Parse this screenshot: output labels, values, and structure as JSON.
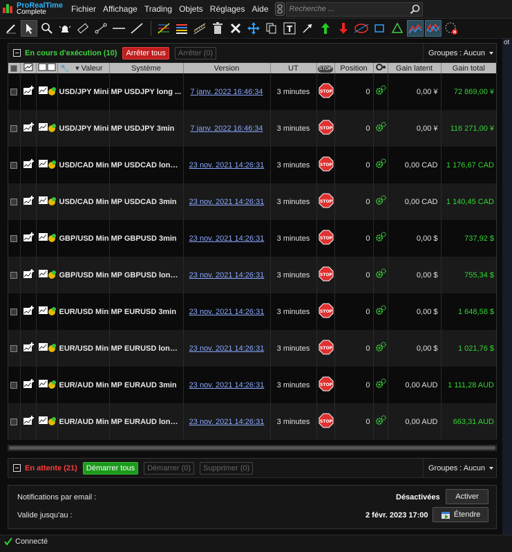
{
  "app": {
    "brand_line1": "ProRealTime",
    "brand_line2": "Complete"
  },
  "menu": [
    "Fichier",
    "Affichage",
    "Trading",
    "Objets",
    "Réglages",
    "Aide"
  ],
  "search": {
    "placeholder": "Recherche ..."
  },
  "running": {
    "title": "En cours d'exécution (10)",
    "stop_all_label": "Arrêter tous",
    "stop_label": "Arrêter (0)",
    "groups_label": "Groupes : Aucun",
    "columns": {
      "valeur": "Valeur",
      "systeme": "Système",
      "version": "Version",
      "ut": "UT",
      "stop": "STOP",
      "position": "Position",
      "gain_latent": "Gain latent",
      "gain_total": "Gain total"
    },
    "rows": [
      {
        "valeur": "USD/JPY Mini",
        "systeme": "MP USDJPY long ...",
        "version": "7 janv. 2022 16:46:34",
        "ut": "3 minutes",
        "position": "0",
        "gain_latent": "0,00 ¥",
        "gain_total": "72 869,00 ¥"
      },
      {
        "valeur": "USD/JPY Mini",
        "systeme": "MP USDJPY 3min",
        "version": "7 janv. 2022 16:46:34",
        "ut": "3 minutes",
        "position": "0",
        "gain_latent": "0,00 ¥",
        "gain_total": "116 271,00 ¥"
      },
      {
        "valeur": "USD/CAD Mini",
        "systeme": "MP USDCAD long ...",
        "version": "23 nov. 2021 14:26:31",
        "ut": "3 minutes",
        "position": "0",
        "gain_latent": "0,00 CAD",
        "gain_total": "1 176,67 CAD"
      },
      {
        "valeur": "USD/CAD Mini",
        "systeme": "MP USDCAD 3min",
        "version": "23 nov. 2021 14:26:31",
        "ut": "3 minutes",
        "position": "0",
        "gain_latent": "0,00 CAD",
        "gain_total": "1 140,45 CAD"
      },
      {
        "valeur": "GBP/USD Mini",
        "systeme": "MP GBPUSD 3min",
        "version": "23 nov. 2021 14:26:31",
        "ut": "3 minutes",
        "position": "0",
        "gain_latent": "0,00 $",
        "gain_total": "737,92 $"
      },
      {
        "valeur": "GBP/USD Mini",
        "systeme": "MP GBPUSD long ...",
        "version": "23 nov. 2021 14:26:31",
        "ut": "3 minutes",
        "position": "0",
        "gain_latent": "0,00 $",
        "gain_total": "755,34 $"
      },
      {
        "valeur": "EUR/USD Mini",
        "systeme": "MP EURUSD 3min",
        "version": "23 nov. 2021 14:26:31",
        "ut": "3 minutes",
        "position": "0",
        "gain_latent": "0,00 $",
        "gain_total": "1 648,58 $"
      },
      {
        "valeur": "EUR/USD Mini",
        "systeme": "MP EURUSD long ...",
        "version": "23 nov. 2021 14:26:31",
        "ut": "3 minutes",
        "position": "0",
        "gain_latent": "0,00 $",
        "gain_total": "1 021,76 $"
      },
      {
        "valeur": "EUR/AUD Mini",
        "systeme": "MP EURAUD 3min",
        "version": "23 nov. 2021 14:26:31",
        "ut": "3 minutes",
        "position": "0",
        "gain_latent": "0,00 AUD",
        "gain_total": "1 111,28 AUD"
      },
      {
        "valeur": "EUR/AUD Mini",
        "systeme": "MP EURAUD long ...",
        "version": "23 nov. 2021 14:26:31",
        "ut": "3 minutes",
        "position": "0",
        "gain_latent": "0,00 AUD",
        "gain_total": "663,31 AUD"
      }
    ]
  },
  "pending": {
    "title": "En attente (21)",
    "start_all_label": "Démarrer tous",
    "start_label": "Démarrer (0)",
    "delete_label": "Supprimer (0)",
    "groups_label": "Groupes : Aucun"
  },
  "notifications": {
    "email_label": "Notifications par email :",
    "email_status": "Désactivées",
    "activate_label": "Activer",
    "valid_label": "Valide jusqu'au :",
    "valid_date": "2 févr. 2023 17:00",
    "extend_label": "Étendre"
  },
  "status": {
    "text": "Connecté"
  },
  "edge_text": "ot",
  "colors": {
    "gain_positive": "#33d633",
    "version_link": "#8aa8ff",
    "running_title": "#3fd43f",
    "pending_title": "#ff3a3a",
    "stop_button": "#e03030"
  }
}
